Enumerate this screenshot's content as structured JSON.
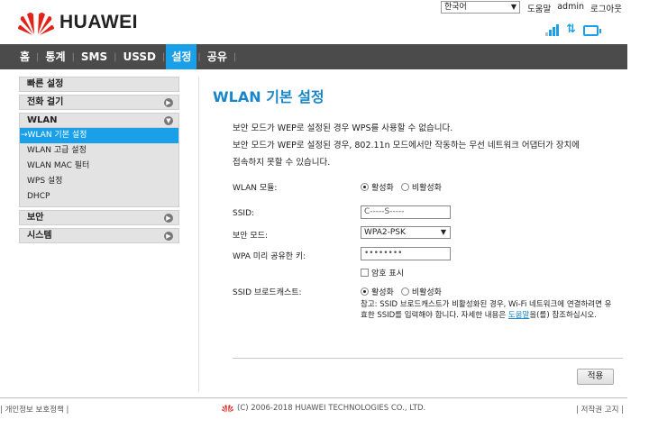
{
  "brand": {
    "name": "HUAWEI",
    "color": "#e2231a"
  },
  "header": {
    "language": "한국어",
    "links": {
      "help": "도움말",
      "user": "admin",
      "logout": "로그아웃"
    },
    "icons": [
      "signal-icon",
      "data-transfer-icon",
      "wifi-display-icon"
    ]
  },
  "nav": {
    "items": [
      "홈",
      "통계",
      "SMS",
      "USSD",
      "설정",
      "공유"
    ],
    "active": "설정",
    "accent": "#1aa0e8"
  },
  "sidebar": {
    "quick_setup": "빠른 설정",
    "dial": "전화 걸기",
    "wlan": "WLAN",
    "wlan_items": [
      "→WLAN 기본 설정",
      "WLAN 고급 설정",
      "WLAN MAC 필터",
      "WPS 설정",
      "DHCP"
    ],
    "security": "보안",
    "system": "시스템"
  },
  "main": {
    "title": "WLAN 기본 설정",
    "desc_line1": "보안 모드가 WEP로 설정된 경우 WPS를 사용할 수 없습니다.",
    "desc_line2": "보안 모드가 WEP로 설정된 경우, 802.11n 모드에서만 작동하는 무선 네트워크 어댑터가 장치에",
    "desc_line3": "접속하지 못할 수 있습니다.",
    "wlan_module_label": "WLAN 모듈:",
    "enable": "활성화",
    "disable": "비활성화",
    "ssid_label": "SSID:",
    "ssid_value": "C-----S-----",
    "security_mode_label": "보안 모드:",
    "security_mode_value": "WPA2-PSK",
    "wpa_key_label": "WPA 미리 공유한 키:",
    "wpa_key_value": "••••••••",
    "show_password": "암호 표시",
    "ssid_broadcast_label": "SSID 브로드캐스트:",
    "note_part1": "참고: SSID 브로드캐스트가 비활성화된 경우, Wi-Fi 네트워크에 연결하려면 유효한 SSID를 입력해야 합니다. 자세한 내용은 ",
    "note_link": "도움말",
    "note_part2": "을(를) 참조하십시오.",
    "apply": "적용"
  },
  "footer": {
    "privacy": "| 개인정보 보호정책 |",
    "copyright": "(C) 2006-2018 HUAWEI TECHNOLOGIES CO., LTD.",
    "rights": "| 저작권 고지 |"
  }
}
